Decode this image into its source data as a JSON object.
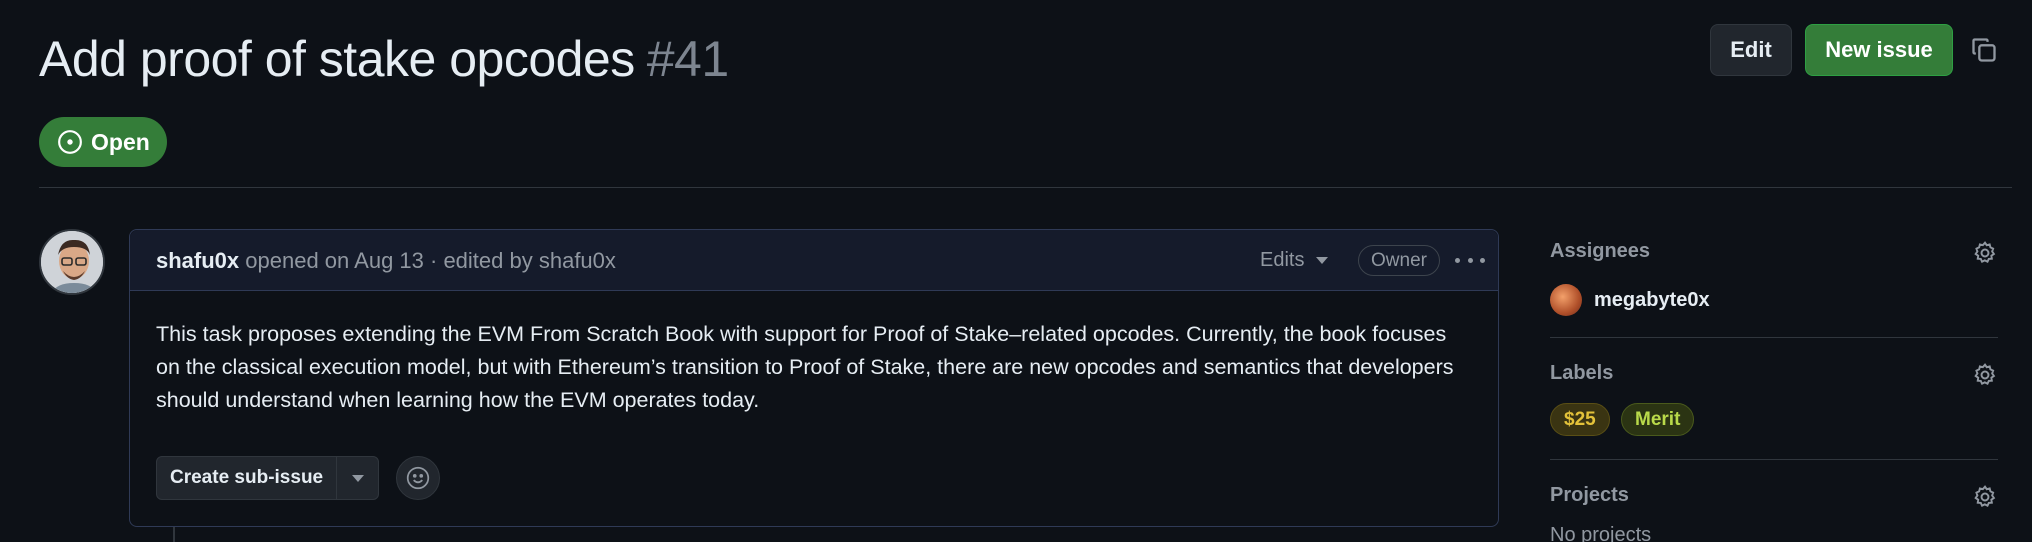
{
  "issue": {
    "title": "Add proof of stake opcodes",
    "number": "#41",
    "state": "Open"
  },
  "header_actions": {
    "edit_label": "Edit",
    "new_issue_label": "New issue"
  },
  "comment": {
    "author": "shafu0x",
    "meta": " opened on Aug 13 · edited by shafu0x",
    "edits_label": "Edits",
    "role_badge": "Owner",
    "body": "This task proposes extending the EVM From Scratch Book with support for Proof of Stake–related opcodes. Currently, the book focuses on the classical execution model, but with Ethereum’s transition to Proof of Stake, there are new opcodes and semantics that developers should understand when learning how the EVM operates today.",
    "create_sub_issue_label": "Create sub-issue"
  },
  "sidebar": {
    "assignees": {
      "heading": "Assignees",
      "items": [
        "megabyte0x"
      ]
    },
    "labels": {
      "heading": "Labels",
      "items": [
        {
          "name": "$25",
          "color": "#e3c23a"
        },
        {
          "name": "Merit",
          "color": "#b9d94a"
        }
      ]
    },
    "projects": {
      "heading": "Projects",
      "empty_text": "No projects"
    }
  },
  "colors": {
    "background": "#0d1117",
    "open_green": "#347d39",
    "border": "#30363d"
  },
  "icons": [
    "issue-open-icon",
    "copy-icon",
    "kebab-icon",
    "chevron-down-icon",
    "smiley-icon",
    "gear-icon"
  ]
}
